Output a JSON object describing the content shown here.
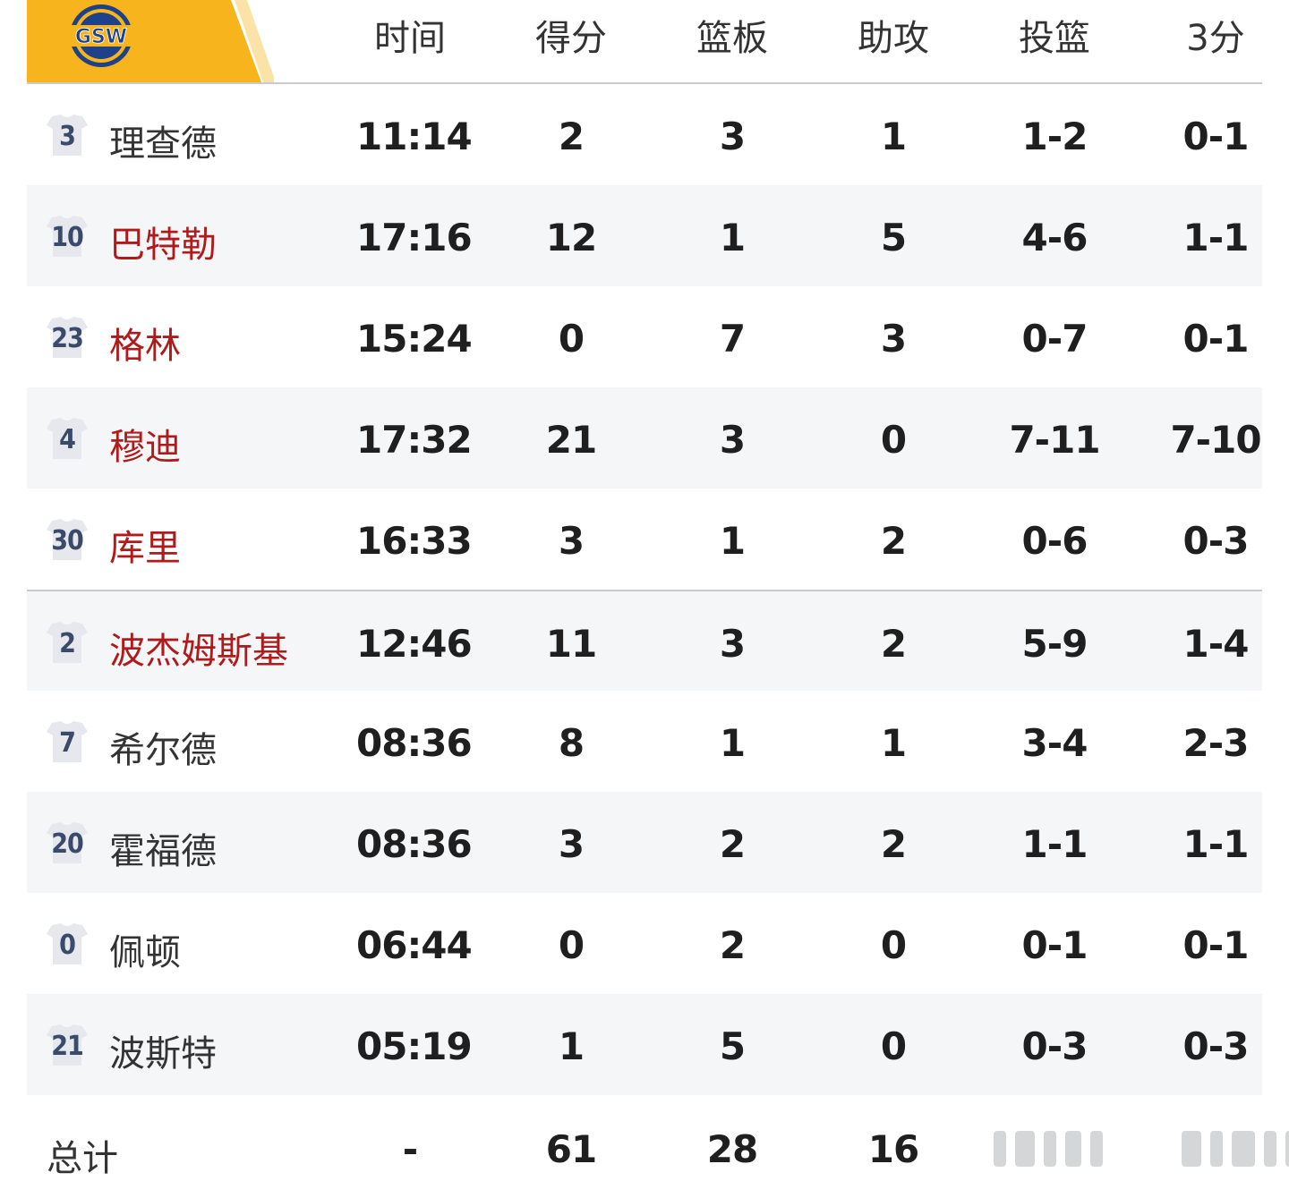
{
  "team": {
    "logo_text": "GSW",
    "brand_color": "#f8b41c",
    "logo_navy": "#1d428a"
  },
  "header": {
    "columns": [
      "时间",
      "得分",
      "篮板",
      "助攻",
      "投篮",
      "3分"
    ]
  },
  "players": [
    {
      "num": "3",
      "name": "理查德",
      "starter": false,
      "min": "11:14",
      "pts": "2",
      "reb": "3",
      "ast": "1",
      "fg": "1-2",
      "tp": "0-1"
    },
    {
      "num": "10",
      "name": "巴特勒",
      "starter": true,
      "min": "17:16",
      "pts": "12",
      "reb": "1",
      "ast": "5",
      "fg": "4-6",
      "tp": "1-1"
    },
    {
      "num": "23",
      "name": "格林",
      "starter": true,
      "min": "15:24",
      "pts": "0",
      "reb": "7",
      "ast": "3",
      "fg": "0-7",
      "tp": "0-1"
    },
    {
      "num": "4",
      "name": "穆迪",
      "starter": true,
      "min": "17:32",
      "pts": "21",
      "reb": "3",
      "ast": "0",
      "fg": "7-11",
      "tp": "7-10"
    },
    {
      "num": "30",
      "name": "库里",
      "starter": true,
      "min": "16:33",
      "pts": "3",
      "reb": "1",
      "ast": "2",
      "fg": "0-6",
      "tp": "0-3"
    },
    {
      "num": "2",
      "name": "波杰姆斯基",
      "starter": true,
      "min": "12:46",
      "pts": "11",
      "reb": "3",
      "ast": "2",
      "fg": "5-9",
      "tp": "1-4"
    },
    {
      "num": "7",
      "name": "希尔德",
      "starter": false,
      "min": "08:36",
      "pts": "8",
      "reb": "1",
      "ast": "1",
      "fg": "3-4",
      "tp": "2-3"
    },
    {
      "num": "20",
      "name": "霍福德",
      "starter": false,
      "min": "08:36",
      "pts": "3",
      "reb": "2",
      "ast": "2",
      "fg": "1-1",
      "tp": "1-1"
    },
    {
      "num": "0",
      "name": "佩顿",
      "starter": false,
      "min": "06:44",
      "pts": "0",
      "reb": "2",
      "ast": "0",
      "fg": "0-1",
      "tp": "0-1"
    },
    {
      "num": "21",
      "name": "波斯特",
      "starter": false,
      "min": "05:19",
      "pts": "1",
      "reb": "5",
      "ast": "0",
      "fg": "0-3",
      "tp": "0-3"
    }
  ],
  "totals": {
    "label": "总计",
    "min": "-",
    "pts": "61",
    "reb": "28",
    "ast": "16"
  },
  "colors": {
    "starter_name": "#b01a1a",
    "bench_name": "#333333",
    "alt_row": "#f5f6f8"
  }
}
